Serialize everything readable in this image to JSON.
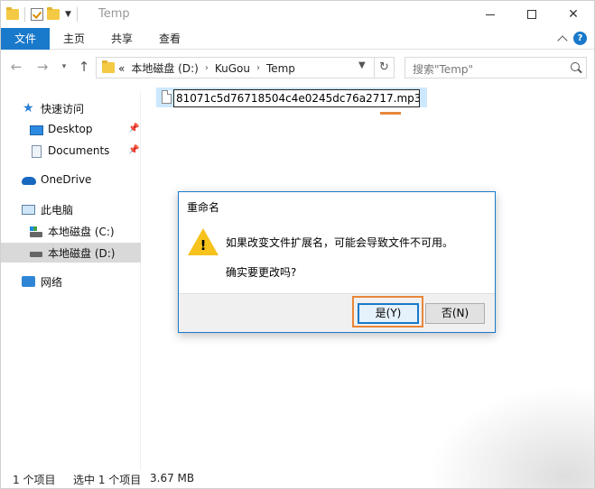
{
  "window": {
    "title": "Temp",
    "controls": {
      "minimize": "—",
      "maximize": "□",
      "close": "✕"
    }
  },
  "ribbon": {
    "tabs": [
      {
        "label": "文件"
      },
      {
        "label": "主页"
      },
      {
        "label": "共享"
      },
      {
        "label": "查看"
      }
    ],
    "help": "?"
  },
  "address": {
    "overflow": "«",
    "crumbs": [
      "本地磁盘 (D:)",
      "KuGou",
      "Temp"
    ],
    "search_placeholder": "搜索\"Temp\""
  },
  "sidebar": {
    "items": [
      {
        "label": "快速访问"
      },
      {
        "label": "Desktop"
      },
      {
        "label": "Documents"
      },
      {
        "label": "OneDrive"
      },
      {
        "label": "此电脑"
      },
      {
        "label": "本地磁盘 (C:)"
      },
      {
        "label": "本地磁盘 (D:)"
      },
      {
        "label": "网络"
      }
    ]
  },
  "file": {
    "rename_value": "81071c5d76718504c4e0245dc76a2717.mp3"
  },
  "dialog": {
    "title": "重命名",
    "message": "如果改变文件扩展名，可能会导致文件不可用。",
    "question": "确实要更改吗?",
    "yes_label": "是(Y)",
    "no_label": "否(N)",
    "warning_mark": "!"
  },
  "status": {
    "item_count": "1 个项目",
    "selected": "选中 1 个项目",
    "size": "3.67 MB"
  },
  "colors": {
    "accent": "#1979ca",
    "highlight": "#e8873a",
    "selection": "#cce8ff"
  }
}
